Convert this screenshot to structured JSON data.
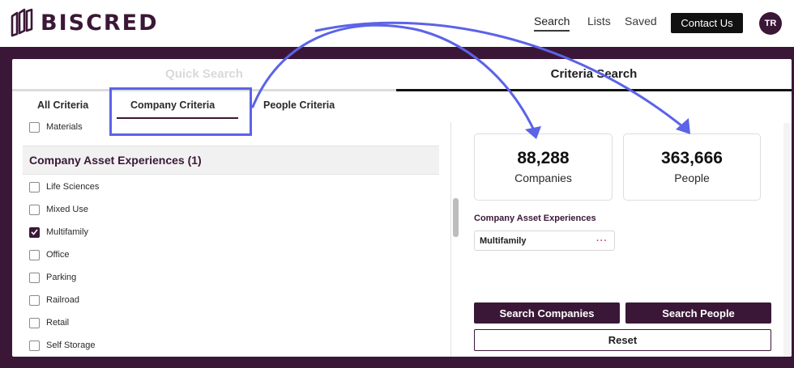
{
  "brand": {
    "name": "BISCRED"
  },
  "nav": {
    "search": "Search",
    "lists": "Lists",
    "saved": "Saved",
    "contact": "Contact Us",
    "avatar_initials": "TR"
  },
  "mode_tabs": {
    "quick": "Quick Search",
    "criteria": "Criteria Search"
  },
  "sub_tabs": {
    "all": "All Criteria",
    "company": "Company Criteria",
    "people": "People Criteria"
  },
  "left": {
    "prev_item": "Materials",
    "section_title": "Company Asset Experiences (1)",
    "options": [
      {
        "label": "Life Sciences",
        "checked": false
      },
      {
        "label": "Mixed Use",
        "checked": false
      },
      {
        "label": "Multifamily",
        "checked": true
      },
      {
        "label": "Office",
        "checked": false
      },
      {
        "label": "Parking",
        "checked": false
      },
      {
        "label": "Railroad",
        "checked": false
      },
      {
        "label": "Retail",
        "checked": false
      },
      {
        "label": "Self Storage",
        "checked": false
      }
    ]
  },
  "results": {
    "companies": {
      "count": "88,288",
      "label": "Companies"
    },
    "people": {
      "count": "363,666",
      "label": "People"
    }
  },
  "selected_filters": {
    "title": "Company Asset Experiences",
    "chip": "Multifamily",
    "chip_menu": "···"
  },
  "actions": {
    "search_companies": "Search Companies",
    "search_people": "Search People",
    "reset": "Reset"
  },
  "colors": {
    "brand": "#3b1737",
    "annotation": "#5b63e8"
  }
}
